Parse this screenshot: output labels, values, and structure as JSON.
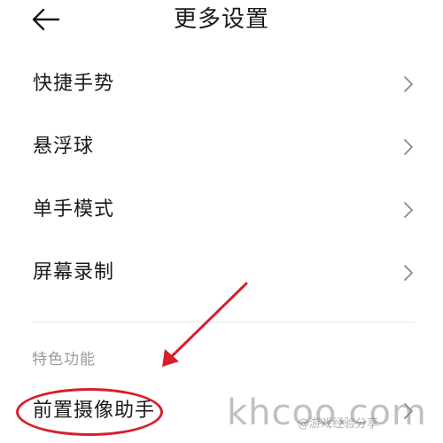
{
  "header": {
    "title": "更多设置",
    "back_icon": "arrow-left-icon"
  },
  "menu": {
    "items": [
      {
        "label": "快捷手势",
        "icon": "chevron-right-icon"
      },
      {
        "label": "悬浮球",
        "icon": "chevron-right-icon"
      },
      {
        "label": "单手模式",
        "icon": "chevron-right-icon"
      },
      {
        "label": "屏幕录制",
        "icon": "chevron-right-icon"
      }
    ]
  },
  "section": {
    "title": "特色功能",
    "items": [
      {
        "label": "前置摄像助手",
        "icon": "chevron-right-icon"
      }
    ]
  },
  "annotation": {
    "color": "#d81e2b"
  },
  "watermark": {
    "site": "khcoo.com",
    "credit": "@游戏经验分享"
  }
}
